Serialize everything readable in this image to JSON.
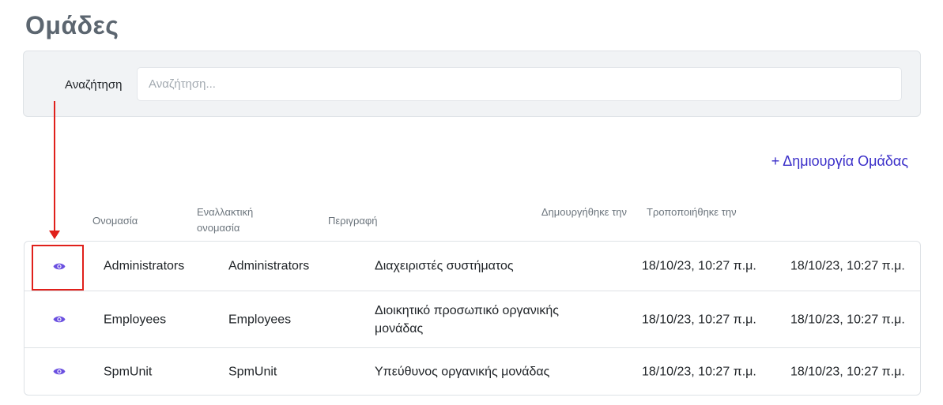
{
  "page": {
    "title": "Ομάδες"
  },
  "search": {
    "label": "Αναζήτηση",
    "placeholder": "Αναζήτηση..."
  },
  "actions": {
    "create_label": "+ Δημιουργία Ομάδας"
  },
  "table": {
    "headers": {
      "name": "Ονομασία",
      "alt_name": "Εναλλακτική ονομασία",
      "description": "Περιγραφή",
      "created": "Δημουργήθηκε την",
      "modified": "Τροποποιήθηκε την"
    },
    "rows": [
      {
        "name": "Administrators",
        "alt_name": "Administrators",
        "description": "Διαχειριστές συστήματος",
        "created": "18/10/23, 10:27 π.μ.",
        "modified": "18/10/23, 10:27 π.μ."
      },
      {
        "name": "Employees",
        "alt_name": "Employees",
        "description": "Διοικητικό προσωπικό οργανικής μονάδας",
        "created": "18/10/23, 10:27 π.μ.",
        "modified": "18/10/23, 10:27 π.μ."
      },
      {
        "name": "SpmUnit",
        "alt_name": "SpmUnit",
        "description": "Υπεύθυνος οργανικής μονάδας",
        "created": "18/10/23, 10:27 π.μ.",
        "modified": "18/10/23, 10:27 π.μ."
      }
    ]
  },
  "icons": {
    "view": "eye-icon"
  },
  "colors": {
    "accent": "#3b2fc9",
    "eye": "#6a4fe0",
    "annotation": "#e0201b",
    "panel_bg": "#f1f3f5"
  }
}
